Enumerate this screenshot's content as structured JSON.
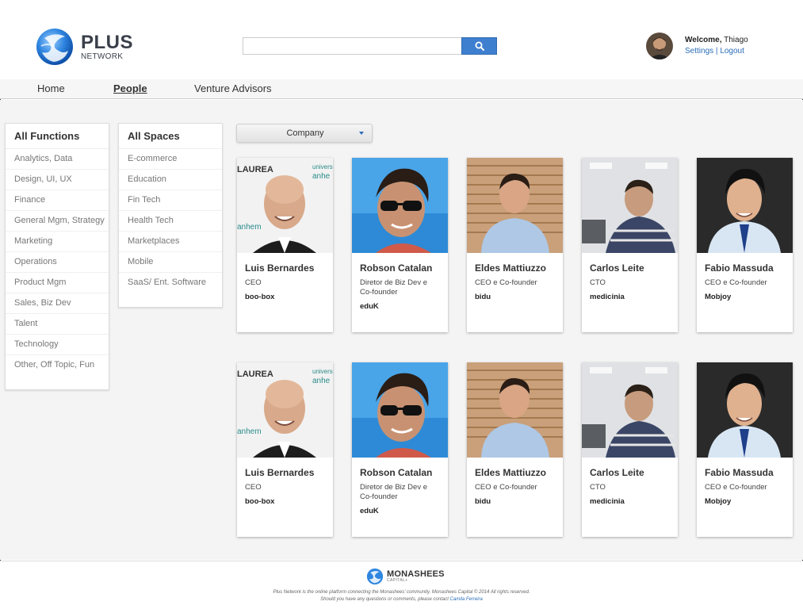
{
  "header": {
    "logo_title": "PLUS",
    "logo_subtitle": "NETWORK",
    "search_placeholder": "",
    "welcome_label": "Welcome,",
    "user_name": "Thiago",
    "settings_label": "Settings",
    "separator": "|",
    "logout_label": "Logout"
  },
  "nav": {
    "items": [
      {
        "label": "Home"
      },
      {
        "label": "People"
      },
      {
        "label": "Venture Advisors"
      }
    ],
    "active": "People"
  },
  "functions": {
    "title": "All Functions",
    "items": [
      "Analytics, Data",
      "Design, UI, UX",
      "Finance",
      "General Mgm, Strategy",
      "Marketing",
      "Operations",
      "Product Mgm",
      "Sales, Biz Dev",
      "Talent",
      "Technology",
      "Other, Off Topic, Fun"
    ]
  },
  "spaces": {
    "title": "All Spaces",
    "items": [
      "E-commerce",
      "Education",
      "Fin Tech",
      "Health Tech",
      "Marketplaces",
      "Mobile",
      "SaaS/ Ent. Software"
    ]
  },
  "company_filter": {
    "selected": "Company"
  },
  "people": [
    {
      "name": "Luis Bernardes",
      "title": "CEO",
      "company": "boo-box"
    },
    {
      "name": "Robson Catalan",
      "title": "Diretor de Biz Dev e Co-founder",
      "company": "eduK"
    },
    {
      "name": "Eldes Mattiuzzo",
      "title": "CEO e Co-founder",
      "company": "bidu"
    },
    {
      "name": "Carlos Leite",
      "title": "CTO",
      "company": "medicinia"
    },
    {
      "name": "Fabio Massuda",
      "title": "CEO e Co-founder",
      "company": "Mobjoy"
    },
    {
      "name": "Luis Bernardes",
      "title": "CEO",
      "company": "boo-box"
    },
    {
      "name": "Robson Catalan",
      "title": "Diretor de Biz Dev e Co-founder",
      "company": "eduK"
    },
    {
      "name": "Eldes Mattiuzzo",
      "title": "CEO e Co-founder",
      "company": "bidu"
    },
    {
      "name": "Carlos Leite",
      "title": "CTO",
      "company": "medicinia"
    },
    {
      "name": "Fabio Massuda",
      "title": "CEO e Co-founder",
      "company": "Mobjoy"
    }
  ],
  "footer": {
    "brand": "MONASHEES",
    "brand_sub": "CAPITAL+",
    "line1": "Plus Network is the online platform connecting the Monashees' community. Monashees Capital © 2014 All rights reserved.",
    "line2_prefix": "Should you have any questions or comments, please contact",
    "contact_name": "Camila Ferreira"
  },
  "colors": {
    "accent": "#2a6db8",
    "search_button": "#3f7fcf",
    "background": "#f4f4f4"
  }
}
